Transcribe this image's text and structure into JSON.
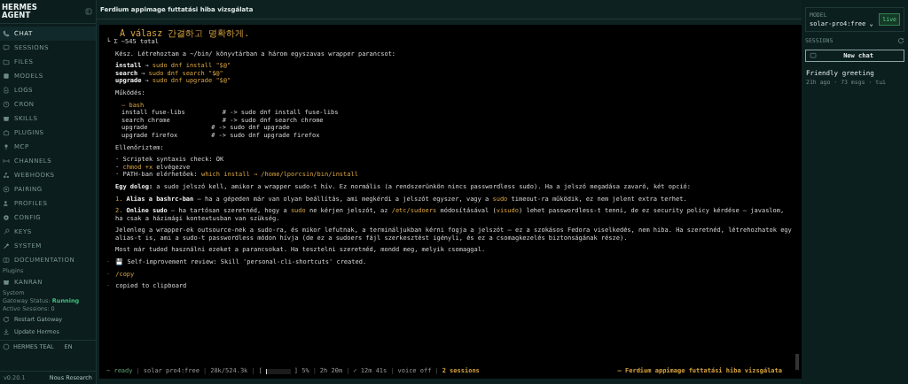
{
  "sidebar": {
    "brand": "HERMES AGENT",
    "nav": [
      {
        "label": "CHAT",
        "selected": true
      },
      {
        "label": "SESSIONS",
        "selected": false
      },
      {
        "label": "FILES",
        "selected": false
      },
      {
        "label": "MODELS",
        "selected": false
      },
      {
        "label": "LOGS",
        "selected": false
      },
      {
        "label": "CRON",
        "selected": false
      },
      {
        "label": "SKILLS",
        "selected": false
      },
      {
        "label": "PLUGINS",
        "selected": false
      },
      {
        "label": "MCP",
        "selected": false
      },
      {
        "label": "CHANNELS",
        "selected": false
      },
      {
        "label": "WEBHOOKS",
        "selected": false
      },
      {
        "label": "PAIRING",
        "selected": false
      },
      {
        "label": "PROFILES",
        "selected": false
      },
      {
        "label": "CONFIG",
        "selected": false
      },
      {
        "label": "KEYS",
        "selected": false
      },
      {
        "label": "SYSTEM",
        "selected": false
      },
      {
        "label": "DOCUMENTATION",
        "selected": false
      }
    ],
    "plugins_label": "Plugins",
    "plugins": [
      {
        "label": "KANRAN",
        "selected": false
      }
    ],
    "system_label": "System",
    "gateway_label": "Gateway Status:",
    "gateway_status": "Running",
    "active_sessions": "Active Sessions: 0",
    "actions": [
      "Restart Gateway",
      "Update Hermes"
    ],
    "theme": "HERMES TEAL",
    "language": "EN",
    "version": "v0.20.1",
    "vendor": "Nous Research"
  },
  "header": {
    "title": "Ferdium appimage futtatási hiba vizsgálata"
  },
  "terminal": {
    "blocks": [
      {
        "kind": "quote",
        "lines": [
          [
            {
              "kind": "code",
              "text": "A válasz 간결하고 명확하게."
            }
          ],
          [
            {
              "kind": "plain",
              "text": "└ Σ ~545 total"
            }
          ]
        ]
      },
      {
        "kind": "body",
        "lines": [
          [
            {
              "kind": "plain",
              "text": "Kész. Létrehoztam a ~/bin/ könyvtárban a három egyszavas wrapper parancsot:"
            }
          ]
        ]
      },
      {
        "kind": "body",
        "lines": [
          [
            {
              "kind": "bold",
              "text": "install"
            },
            {
              "kind": "arrow",
              "text": "→"
            },
            {
              "kind": "code",
              "text": "sudo dnf install \"$@\""
            }
          ],
          [
            {
              "kind": "bold",
              "text": "search"
            },
            {
              "kind": "arrow",
              "text": "→"
            },
            {
              "kind": "code",
              "text": "sudo dnf search \"$@\""
            }
          ],
          [
            {
              "kind": "bold",
              "text": "upgrade"
            },
            {
              "kind": "arrow",
              "text": "→"
            },
            {
              "kind": "code",
              "text": "sudo dnf upgrade \"$@\""
            }
          ]
        ]
      },
      {
        "kind": "body",
        "lines": [
          [
            {
              "kind": "plain",
              "text": "Működés:"
            }
          ]
        ]
      },
      {
        "kind": "code",
        "lines": [
          [
            {
              "kind": "code",
              "text": "– bash"
            }
          ],
          [
            {
              "kind": "plain",
              "text": "install fuse-libs          # -> sudo dnf install fuse-libs"
            }
          ],
          [
            {
              "kind": "plain",
              "text": "search chrome              # -> sudo dnf search chrome"
            }
          ],
          [
            {
              "kind": "plain",
              "text": "upgrade                 # -> sudo dnf upgrade"
            }
          ],
          [
            {
              "kind": "plain",
              "text": "upgrade firefox         # -> sudo dnf upgrade firefox"
            }
          ]
        ]
      },
      {
        "kind": "body",
        "lines": [
          [
            {
              "kind": "plain",
              "text": "Ellenőriztem:"
            }
          ]
        ]
      },
      {
        "kind": "body",
        "lines": [
          [
            {
              "kind": "plain",
              "text": "· Scriptek syntaxis check: OK"
            }
          ],
          [
            {
              "kind": "plain",
              "text": "· "
            },
            {
              "kind": "code",
              "text": "chmod +x"
            },
            {
              "kind": "plain",
              "text": " elvégezve"
            }
          ],
          [
            {
              "kind": "plain",
              "text": "· PATH-ban elérhetőek: "
            },
            {
              "kind": "code",
              "text": "which install → /home/lporcsin/bin/install"
            }
          ]
        ]
      },
      {
        "kind": "body",
        "lines": [
          [
            {
              "kind": "bold",
              "text": "Egy dolog:"
            },
            {
              "kind": "plain",
              "text": " a sudo jelszó kell, amikor a wrapper sudo-t hív. Ez normális (a rendszerünkön nincs passwordless sudo). Ha a jelszó megadása zavaró, két opció:"
            }
          ]
        ]
      },
      {
        "kind": "body",
        "lines": [
          [
            {
              "kind": "number",
              "text": "1."
            },
            {
              "kind": "bold",
              "text": "Alias a bashrc-ban"
            },
            {
              "kind": "plain",
              "text": " — ha a gépeden már van olyan beállítás, ami megkérdi a jelszót egyszer, vagy a "
            },
            {
              "kind": "code",
              "text": "sudo"
            },
            {
              "kind": "plain",
              "text": " timeout-ra működik, ez nem jelent extra terhet."
            }
          ]
        ]
      },
      {
        "kind": "body",
        "lines": [
          [
            {
              "kind": "number",
              "text": "2."
            },
            {
              "kind": "bold",
              "text": "Online sudo"
            },
            {
              "kind": "plain",
              "text": " — ha tartósan szeretnéd, hogy a "
            },
            {
              "kind": "code",
              "text": "sudo"
            },
            {
              "kind": "plain",
              "text": " ne kérjen jelszót, az "
            },
            {
              "kind": "code",
              "text": "/etc/sudoers"
            },
            {
              "kind": "plain",
              "text": " módosításával ("
            },
            {
              "kind": "code",
              "text": "visudo"
            },
            {
              "kind": "plain",
              "text": ") lehet passwordless-t tenni, de ez security policy kérdése — javaslom, ha csak a házimági kontextusban van szükség."
            }
          ]
        ]
      },
      {
        "kind": "body",
        "lines": [
          [
            {
              "kind": "plain",
              "text": "Jelenleg a wrapper-ek outsource-nek a sudo-ra, és mikor lefutnak, a termináljukban kérni fogja a jelszót — ez a szokásos Fedora viselkedés, nem hiba. Ha szeretnéd, létrehozhatok egy alias-t is, ami a sudo-t passwordless módon hívja (de ez a sudoers fájl szerkesztést igényli, és ez a csomagkezelés biztonságának része)."
            }
          ]
        ]
      },
      {
        "kind": "body",
        "lines": [
          [
            {
              "kind": "plain",
              "text": "Most már tudod használni ezeket a parancsokat. Ha tesztelni szeretnéd, mondd meg, melyik csomaggal."
            }
          ]
        ]
      },
      {
        "kind": "event",
        "lines": [
          [
            {
              "kind": "dim",
              "text": "·"
            },
            {
              "kind": "plain",
              "text": "💾 Self-improvement review: Skill 'personal-cli-shortcuts' created."
            }
          ]
        ]
      },
      {
        "kind": "event",
        "lines": [
          [
            {
              "kind": "dim",
              "text": "·"
            },
            {
              "kind": "code",
              "text": "/copy"
            }
          ]
        ]
      },
      {
        "kind": "event",
        "lines": [
          [
            {
              "kind": "dim",
              "text": "·"
            },
            {
              "kind": "plain",
              "text": "copied to clipboard"
            }
          ]
        ]
      }
    ],
    "status": [
      {
        "kind": "ready",
        "text": "~ ready"
      },
      {
        "kind": "sep",
        "text": "|"
      },
      {
        "kind": "text",
        "text": "solar pro4:free"
      },
      {
        "kind": "sep",
        "text": "|"
      },
      {
        "kind": "text",
        "text": "28k/524.3k"
      },
      {
        "kind": "sep",
        "text": "|"
      },
      {
        "kind": "text",
        "text": "["
      },
      {
        "kind": "bar",
        "level": 0.05
      },
      {
        "kind": "text",
        "text": "] 5%"
      },
      {
        "kind": "sep",
        "text": "|"
      },
      {
        "kind": "text",
        "text": "2h 20m"
      },
      {
        "kind": "sep",
        "text": "|"
      },
      {
        "kind": "text",
        "text": "✓ 12m 41s"
      },
      {
        "kind": "sep",
        "text": "|"
      },
      {
        "kind": "text",
        "text": "voice off"
      },
      {
        "kind": "sep",
        "text": "|"
      },
      {
        "kind": "strong",
        "text": "2 sessions"
      },
      {
        "kind": "title",
        "text": "– Ferdium appimage futtatási hiba vizsgálata"
      }
    ]
  },
  "right_panel": {
    "model_label": "MODEL",
    "model": "solar-pro4:free",
    "model_caret": "⌄",
    "live": "live",
    "sessions_label": "SESSIONS",
    "new_chat": "New chat",
    "sessions": [
      {
        "title": "Friendly greeting",
        "meta": "21h ago · 73 msgs · tui",
        "selected": false
      }
    ]
  }
}
